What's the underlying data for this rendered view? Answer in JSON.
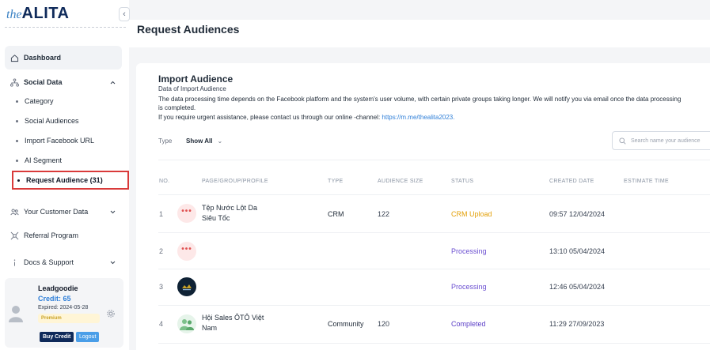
{
  "sidebar": {
    "logo_the": "the",
    "logo_brand": "ALITA",
    "collapse_glyph": "‹",
    "items": {
      "dashboard": "Dashboard",
      "social_data": "Social Data",
      "customer_data": "Your Customer Data",
      "referral": "Referral Program",
      "docs": "Docs & Support"
    },
    "social_sub": [
      "Category",
      "Social Audiences",
      "Import Facebook URL",
      "AI Segment"
    ],
    "active_sub": "Request Audience (31)",
    "user": {
      "name": "Leadgoodie",
      "credit": "Credit: 65",
      "expired": "Expired: 2024-05-28",
      "badge": "Premium",
      "buy_label": "Buy Credit",
      "logout_label": "Logout"
    }
  },
  "header": {
    "title": "Request Audiences"
  },
  "card": {
    "title": "Import Audience",
    "subtitle": "Data of Import Audience",
    "desc_line1": "The data processing time depends on the Facebook platform and the system's user volume, with certain private groups taking longer. We will notify you via email once the data processing",
    "desc_line2": "is completed.",
    "desc_line3_prefix": "If you require urgent assistance, please contact us through our online -channel: ",
    "desc_link": "https://m.me/thealita2023.",
    "filter_label": "Type",
    "filter_value": "Show All",
    "search_placeholder": "Search name your audience"
  },
  "table": {
    "headers": [
      "NO.",
      "PAGE/GROUP/PROFILE",
      "TYPE",
      "AUDIENCE SIZE",
      "STATUS",
      "CREATED DATE",
      "ESTIMATE TIME"
    ],
    "rows": [
      {
        "no": "1",
        "name_line1": "Tệp Nước Lột Da",
        "name_line2": "Siêu Tốc",
        "type": "CRM",
        "size": "122",
        "status": "CRM Upload",
        "created": "09:57 12/04/2024",
        "avatar": "dots"
      },
      {
        "no": "2",
        "name_line1": "",
        "name_line2": "",
        "type": "",
        "size": "",
        "status": "Processing",
        "created": "13:10 05/04/2024",
        "avatar": "dots"
      },
      {
        "no": "3",
        "name_line1": "",
        "name_line2": "",
        "type": "",
        "size": "",
        "status": "Processing",
        "created": "12:46 05/04/2024",
        "avatar": "dark-logo"
      },
      {
        "no": "4",
        "name_line1": "Hội Sales ÔTÔ Việt",
        "name_line2": "Nam",
        "type": "Community",
        "size": "120",
        "status": "Completed",
        "created": "11:29 27/09/2023",
        "avatar": "green-group"
      }
    ]
  },
  "colors": {
    "accent": "#2f7fd8",
    "brand_dark": "#0f2a5a",
    "highlight_border": "#d93a3a",
    "status_crm": "#e3a008",
    "status_processing": "#6b4fd1"
  }
}
